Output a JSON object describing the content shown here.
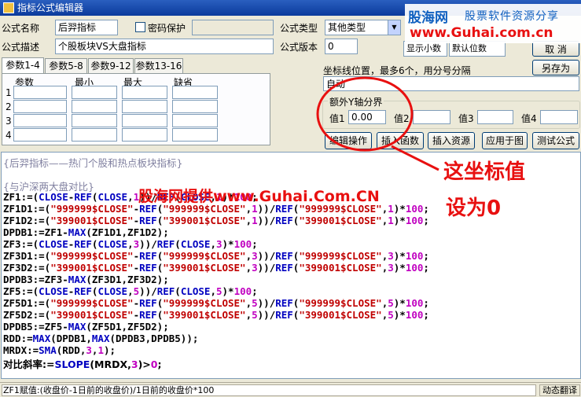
{
  "window": {
    "title": "指标公式编辑器"
  },
  "form": {
    "name_label": "公式名称",
    "name_value": "后羿指标",
    "password_label": "密码保护",
    "type_label": "公式类型",
    "type_value": "其他类型",
    "desc_label": "公式描述",
    "desc_value": "个股板块VS大盘指标",
    "version_label": "公式版本",
    "version_value": "0",
    "partial_select_1": "显示小数",
    "partial_select_2": "默认位数",
    "partial_btn": "取 消",
    "save_as_button": "另存为"
  },
  "tabs": [
    "参数1-4",
    "参数5-8",
    "参数9-12",
    "参数13-16"
  ],
  "param_table": {
    "headers": [
      "参数",
      "最小",
      "最大",
      "缺省"
    ],
    "rows": [
      "1",
      "2",
      "3",
      "4"
    ]
  },
  "axis": {
    "coord_label": "坐标线位置，最多6个，用分号分隔",
    "coord_value": "自动",
    "extra_axis_label": "额外Y轴分界",
    "value_labels": [
      "值1",
      "值2",
      "值3",
      "值4"
    ],
    "value1": "0.00"
  },
  "buttons": {
    "edit": "编辑操作",
    "insert_func": "插入函数",
    "insert_resource": "插入资源",
    "apply_chart": "应用于图",
    "test": "测试公式"
  },
  "code": {
    "comment1": "{后羿指标——热门个股和热点板块指标}",
    "comment2": "{与沪深两大盘对比}",
    "l01": "ZF1:=(CLOSE-REF(CLOSE,1))/REF(CLOSE,1)*100;",
    "l02": "ZF1D1:=(\"999999$CLOSE\"-REF(\"999999$CLOSE\",1))/REF(\"999999$CLOSE\",1)*100;",
    "l03": "ZF1D2:=(\"399001$CLOSE\"-REF(\"399001$CLOSE\",1))/REF(\"399001$CLOSE\",1)*100;",
    "l04": "DPDB1:=ZF1-MAX(ZF1D1,ZF1D2);",
    "l05": "ZF3:=(CLOSE-REF(CLOSE,3))/REF(CLOSE,3)*100;",
    "l06": "ZF3D1:=(\"999999$CLOSE\"-REF(\"999999$CLOSE\",3))/REF(\"999999$CLOSE\",3)*100;",
    "l07": "ZF3D2:=(\"399001$CLOSE\"-REF(\"399001$CLOSE\",3))/REF(\"399001$CLOSE\",3)*100;",
    "l08": "DPDB3:=ZF3-MAX(ZF3D1,ZF3D2);",
    "l09": "ZF5:=(CLOSE-REF(CLOSE,5))/REF(CLOSE,5)*100;",
    "l10": "ZF5D1:=(\"999999$CLOSE\"-REF(\"999999$CLOSE\",5))/REF(\"999999$CLOSE\",5)*100;",
    "l11": "ZF5D2:=(\"399001$CLOSE\"-REF(\"399001$CLOSE\",5))/REF(\"399001$CLOSE\",5)*100;",
    "l12": "DPDB5:=ZF5-MAX(ZF5D1,ZF5D2);",
    "l13": "RDD:=MAX(DPDB1,MAX(DPDB3,DPDB5));",
    "l14": "MRDX:=SMA(RDD,3,1);",
    "l15": "对比斜率:=SLOPE(MRDX,3)>0;"
  },
  "status": {
    "left": "ZF1赋值:(收盘价-1日前的收盘价)/1日前的收盘价*100",
    "right": "动态翻译"
  },
  "annotation": {
    "callout_line1": "这坐标值",
    "callout_line2": "设为0",
    "overlay_text": "股海网提供www.Guhai.Com.CN",
    "color": "#e81010"
  },
  "watermark": {
    "name": "股海网",
    "slogan": "股票软件资源分享",
    "url": "www.Guhai.com.cn"
  }
}
